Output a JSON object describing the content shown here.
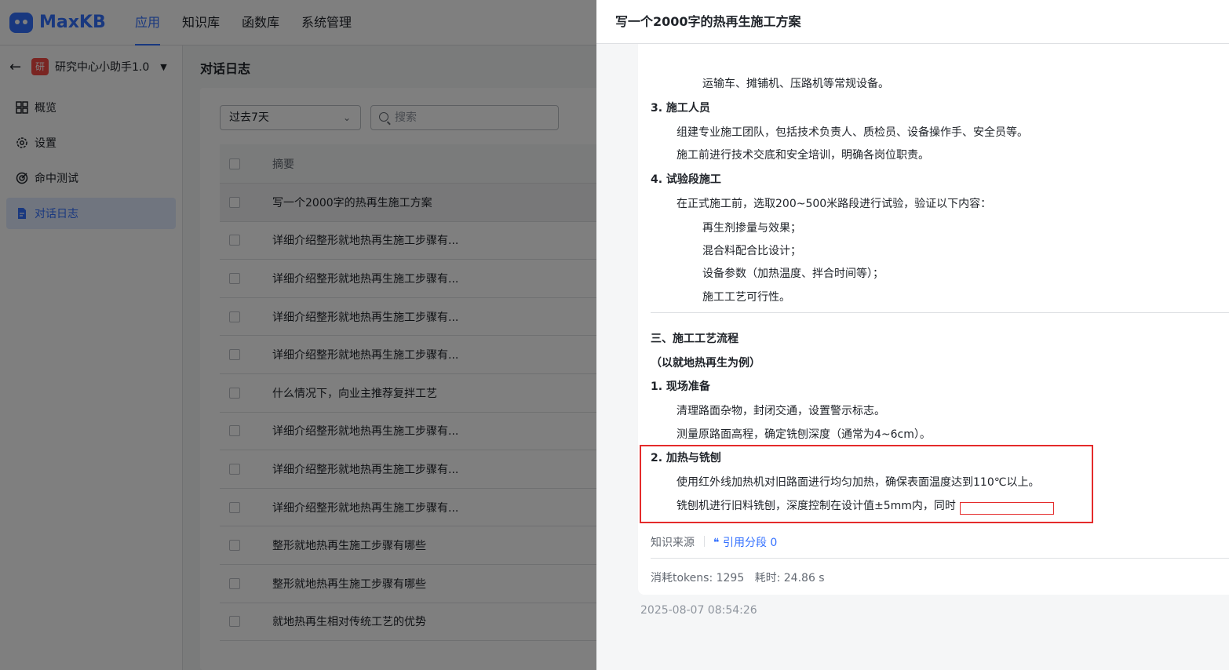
{
  "brand": {
    "name": "MaxKB"
  },
  "topnav": [
    {
      "label": "应用",
      "active": true
    },
    {
      "label": "知识库",
      "active": false
    },
    {
      "label": "函数库",
      "active": false
    },
    {
      "label": "系统管理",
      "active": false
    }
  ],
  "app": {
    "avatar": "研",
    "name": "研究中心小助手1.0"
  },
  "sidebar": {
    "items": [
      {
        "label": "概览",
        "icon": "grid-icon"
      },
      {
        "label": "设置",
        "icon": "gear-icon"
      },
      {
        "label": "命中测试",
        "icon": "target-icon"
      },
      {
        "label": "对话日志",
        "icon": "document-icon",
        "active": true
      }
    ]
  },
  "main": {
    "title": "对话日志",
    "filter": {
      "value": "过去7天"
    },
    "search": {
      "placeholder": "搜索"
    },
    "table": {
      "header": "摘要",
      "rows": [
        "写一个2000字的热再生施工方案",
        "详细介绍整形就地热再生施工步骤有...",
        "详细介绍整形就地热再生施工步骤有...",
        "详细介绍整形就地热再生施工步骤有...",
        "详细介绍整形就地热再生施工步骤有...",
        "什么情况下，向业主推荐复拌工艺",
        "详细介绍整形就地热再生施工步骤有...",
        "详细介绍整形就地热再生施工步骤有...",
        "详细介绍整形就地热再生施工步骤有...",
        "整形就地热再生施工步骤有哪些",
        "整形就地热再生施工步骤有哪些",
        "就地热再生相对传统工艺的优势"
      ]
    }
  },
  "drawer": {
    "title": "写一个2000字的热再生施工方案",
    "lines": [
      "运输车、摊铺机、压路机等常规设备。",
      "3. 施工人员",
      "组建专业施工团队，包括技术负责人、质检员、设备操作手、安全员等。",
      "施工前进行技术交底和安全培训，明确各岗位职责。",
      "4. 试验段施工",
      "在正式施工前，选取200~500米路段进行试验，验证以下内容：",
      "再生剂掺量与效果；",
      "混合料配合比设计；",
      "设备参数（加热温度、拌合时间等）；",
      "施工工艺可行性。",
      "三、施工工艺流程",
      "（以就地热再生为例）",
      "1. 现场准备",
      "清理路面杂物，封闭交通，设置警示标志。",
      "测量原路面高程，确定铣刨深度（通常为4~6cm）。",
      "2. 加热与铣刨",
      "使用红外线加热机对旧路面进行均匀加热，确保表面温度达到110℃以上。",
      "铣刨机进行旧料铣刨，深度控制在设计值±5mm内，同时"
    ],
    "source_label": "知识来源",
    "cite_label": "引用分段 0",
    "tokens_label": "消耗tokens: 1295",
    "time_label": "耗时: 24.86 s",
    "timestamp": "2025-08-07 08:54:26"
  },
  "colors": {
    "accent": "#3370ff",
    "highlight": "#e42b2b",
    "avatar": "#f54a45"
  }
}
